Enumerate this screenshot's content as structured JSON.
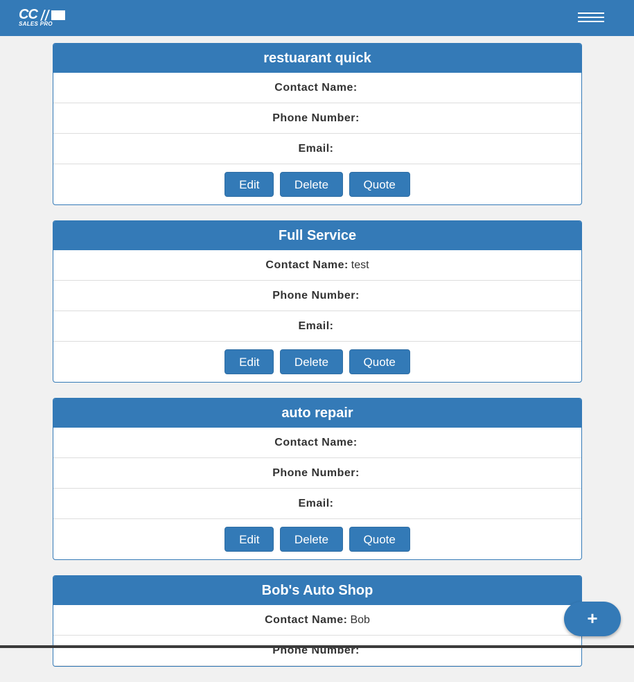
{
  "navbar": {
    "logo_text": "CC",
    "logo_sub": "SALES PRO",
    "menu_icon": "hamburger-icon"
  },
  "labels": {
    "contact": "Contact Name:",
    "phone": "Phone Number:",
    "email": "Email:",
    "edit": "Edit",
    "delete": "Delete",
    "quote": "Quote"
  },
  "customers": [
    {
      "name": "restuarant quick",
      "contact": "",
      "phone": "",
      "email": ""
    },
    {
      "name": "Full Service",
      "contact": "test",
      "phone": "",
      "email": ""
    },
    {
      "name": "auto repair",
      "contact": "",
      "phone": "",
      "email": ""
    },
    {
      "name": "Bob's Auto Shop",
      "contact": "Bob",
      "phone": "",
      "email": ""
    }
  ],
  "fab": {
    "label": "+",
    "icon": "plus-icon"
  },
  "colors": {
    "primary": "#347ab7",
    "background": "#f1f1f1"
  }
}
